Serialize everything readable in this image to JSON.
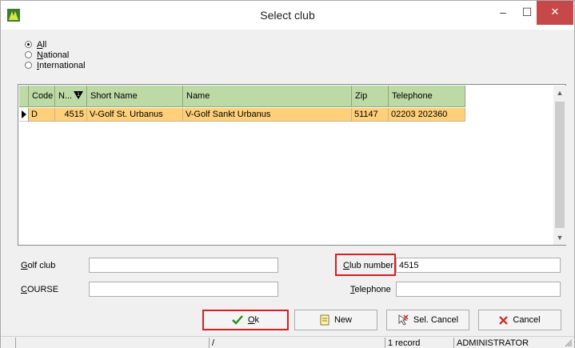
{
  "window": {
    "title": "Select club",
    "controls": {
      "minimize": "–",
      "maximize": "☐",
      "close": "✕"
    }
  },
  "filter": {
    "options": [
      {
        "label": "All",
        "mnemonic": "A",
        "rest": "ll",
        "checked": true
      },
      {
        "label": "National",
        "mnemonic": "N",
        "rest": "ational",
        "checked": false
      },
      {
        "label": "International",
        "mnemonic": "I",
        "rest": "nternational",
        "checked": false
      }
    ]
  },
  "grid": {
    "columns": [
      "Code",
      "N...",
      "Short Name",
      "Name",
      "Zip",
      "Telephone"
    ],
    "rows": [
      {
        "code": "D",
        "number": "4515",
        "short_name": "V-Golf St. Urbanus",
        "name": "V-Golf Sankt Urbanus",
        "zip": "51147",
        "telephone": "02203 202360"
      }
    ],
    "selected_row_color": "#ffcf7a",
    "header_color": "#bdd9a6"
  },
  "form": {
    "golf_club": {
      "label_mnemonic": "G",
      "label_rest": "olf club",
      "value": ""
    },
    "course": {
      "label_mnemonic": "C",
      "label_rest": "OURSE",
      "value": ""
    },
    "club_number": {
      "label_mnemonic": "C",
      "label_rest": "lub number",
      "value": "4515"
    },
    "telephone": {
      "label_mnemonic": "T",
      "label_rest": "elephone",
      "value": ""
    }
  },
  "buttons": {
    "ok": {
      "mnemonic": "O",
      "rest": "k",
      "icon": "checkmark-icon"
    },
    "new": {
      "label": "New",
      "icon": "new-document-icon"
    },
    "sel_cancel": {
      "label": "Sel. Cancel",
      "icon": "deselect-icon"
    },
    "cancel": {
      "label": "Cancel",
      "icon": "x-icon"
    }
  },
  "statusbar": {
    "panel_path": "/",
    "records": "1 record",
    "user": "ADMINISTRATOR"
  },
  "highlight_color": "#d62020"
}
